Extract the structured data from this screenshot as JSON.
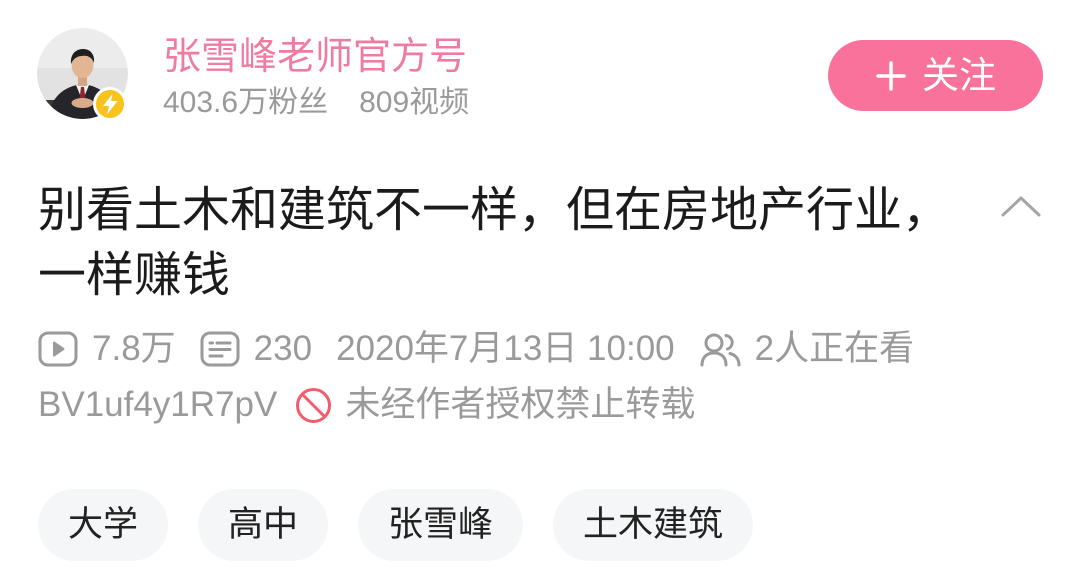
{
  "theme": {
    "accent": "#f8729b",
    "name_color": "#ee7ca1",
    "muted_text": "#9a9a9a",
    "warning": "#f25d6e",
    "verified_badge": "#f8c31d"
  },
  "uploader": {
    "verified_icon": "lightning-icon",
    "name": "张雪峰老师官方号",
    "followers": "403.6万粉丝",
    "videos": "809视频"
  },
  "follow_button": {
    "icon": "plus-icon",
    "label": "关注"
  },
  "video": {
    "title": "别看土木和建筑不一样，但在房地产行业，一样赚钱",
    "collapse_icon": "chevron-up-icon",
    "stats": {
      "plays": {
        "icon": "play-icon",
        "text": "7.8万"
      },
      "danmaku": {
        "icon": "danmaku-icon",
        "text": "230"
      },
      "published": "2020年7月13日 10:00",
      "watching": {
        "icon": "viewers-icon",
        "text": "2人正在看"
      }
    },
    "bvid": "BV1uf4y1R7pV",
    "copyright": {
      "icon": "forbidden-icon",
      "text": "未经作者授权禁止转载"
    }
  },
  "tags": [
    "大学",
    "高中",
    "张雪峰",
    "土木建筑"
  ]
}
